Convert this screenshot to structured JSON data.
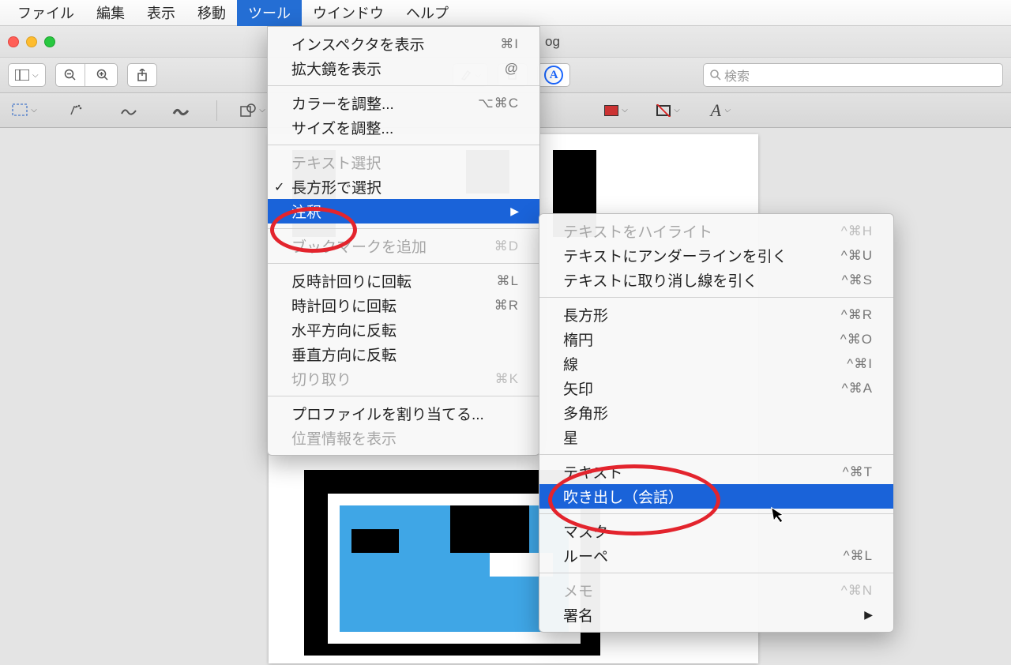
{
  "menubar": [
    "ファイル",
    "編集",
    "表示",
    "移動",
    "ツール",
    "ウインドウ",
    "ヘルプ"
  ],
  "menubar_active_index": 4,
  "window_title_suffix": "og",
  "search_placeholder": "検索",
  "tool_menu": [
    {
      "type": "item",
      "label": "インスペクタを表示",
      "sc": "⌘I"
    },
    {
      "type": "item",
      "label": "拡大鏡を表示",
      "sc": "@"
    },
    {
      "type": "sep"
    },
    {
      "type": "item",
      "label": "カラーを調整...",
      "sc": "⌥⌘C"
    },
    {
      "type": "item",
      "label": "サイズを調整..."
    },
    {
      "type": "sep"
    },
    {
      "type": "item",
      "label": "テキスト選択",
      "disabled": true
    },
    {
      "type": "item",
      "label": "長方形で選択",
      "checked": true
    },
    {
      "type": "sub",
      "label": "注釈",
      "hl": true
    },
    {
      "type": "sep"
    },
    {
      "type": "item",
      "label": "ブックマークを追加",
      "sc": "⌘D",
      "disabled": true
    },
    {
      "type": "sep"
    },
    {
      "type": "item",
      "label": "反時計回りに回転",
      "sc": "⌘L"
    },
    {
      "type": "item",
      "label": "時計回りに回転",
      "sc": "⌘R"
    },
    {
      "type": "item",
      "label": "水平方向に反転"
    },
    {
      "type": "item",
      "label": "垂直方向に反転"
    },
    {
      "type": "item",
      "label": "切り取り",
      "sc": "⌘K",
      "disabled": true
    },
    {
      "type": "sep"
    },
    {
      "type": "item",
      "label": "プロファイルを割り当てる..."
    },
    {
      "type": "item",
      "label": "位置情報を表示",
      "disabled": true
    }
  ],
  "annot_menu": [
    {
      "type": "item",
      "label": "テキストをハイライト",
      "sc": "^⌘H",
      "disabled": true
    },
    {
      "type": "item",
      "label": "テキストにアンダーラインを引く",
      "sc": "^⌘U"
    },
    {
      "type": "item",
      "label": "テキストに取り消し線を引く",
      "sc": "^⌘S"
    },
    {
      "type": "sep"
    },
    {
      "type": "item",
      "label": "長方形",
      "sc": "^⌘R"
    },
    {
      "type": "item",
      "label": "楕円",
      "sc": "^⌘O"
    },
    {
      "type": "item",
      "label": "線",
      "sc": "^⌘I"
    },
    {
      "type": "item",
      "label": "矢印",
      "sc": "^⌘A"
    },
    {
      "type": "item",
      "label": "多角形"
    },
    {
      "type": "item",
      "label": "星"
    },
    {
      "type": "sep"
    },
    {
      "type": "item",
      "label": "テキスト",
      "sc": "^⌘T"
    },
    {
      "type": "item",
      "label": "吹き出し（会話）",
      "hl": true
    },
    {
      "type": "sep"
    },
    {
      "type": "item",
      "label": "マスク"
    },
    {
      "type": "item",
      "label": "ルーペ",
      "sc": "^⌘L"
    },
    {
      "type": "sep"
    },
    {
      "type": "item",
      "label": "メモ",
      "sc": "^⌘N",
      "disabled": true
    },
    {
      "type": "sub",
      "label": "署名"
    }
  ]
}
